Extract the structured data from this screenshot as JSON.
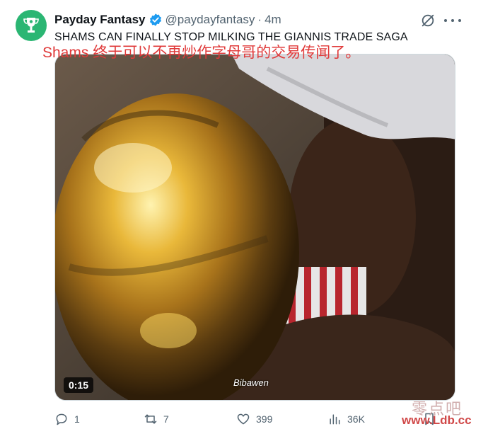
{
  "author": {
    "display_name": "Payday Fantasy",
    "handle": "@paydayfantasy",
    "time_sep": "·",
    "time": "4m"
  },
  "tweet": {
    "text": "SHAMS CAN FINALLY STOP MILKING THE GIANNIS TRADE SAGA",
    "caption_overlay": "Shams 终于可以不再炒作字母哥的交易传闻了。"
  },
  "media": {
    "duration": "0:15",
    "video_watermark": "Bibawen"
  },
  "actions": {
    "replies": "1",
    "reposts": "7",
    "likes": "399",
    "views": "36K"
  },
  "site_watermark": {
    "chinese": "零点吧",
    "url": "www.Ldb.cc"
  },
  "colors": {
    "avatar_bg": "#2bb673",
    "verified": "#1d9bf0",
    "muted": "#536471",
    "caption_red": "#e03a3a"
  }
}
